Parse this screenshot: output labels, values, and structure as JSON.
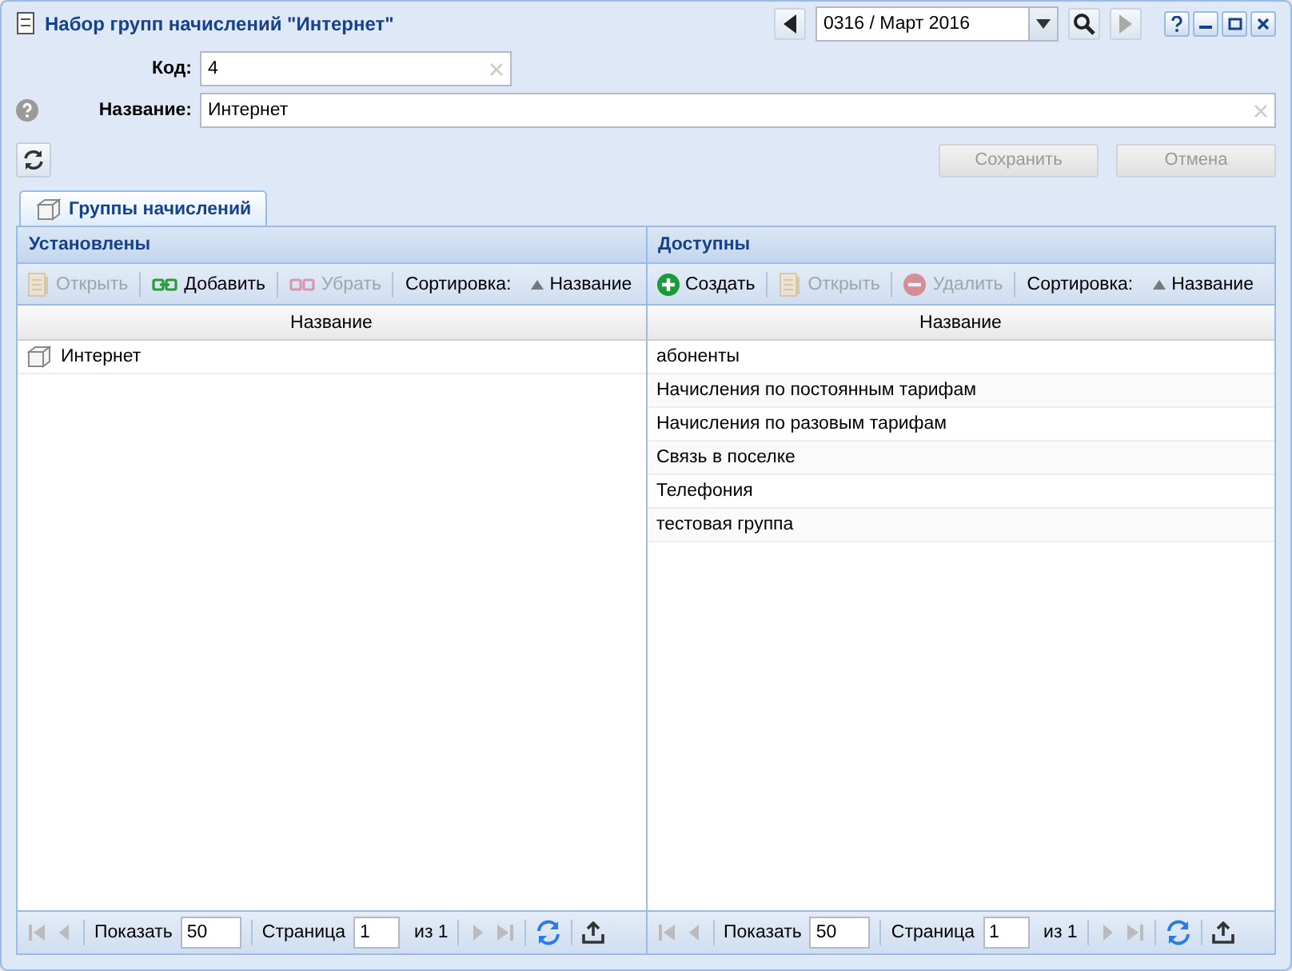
{
  "window": {
    "title": "Набор групп начислений \"Интернет\""
  },
  "period": {
    "value": "0316 / Март 2016",
    "next_disabled": true
  },
  "fields": [
    {
      "label": "Код:",
      "value": "4",
      "help": false
    },
    {
      "label": "Название:",
      "value": "Интернет",
      "help": true
    }
  ],
  "buttons": [
    {
      "label": "Сохранить",
      "disabled": true
    },
    {
      "label": "Отмена",
      "disabled": true
    }
  ],
  "tabs": [
    {
      "label": "Группы начислений",
      "selected": true
    }
  ],
  "panels": [
    {
      "title": "Установлены",
      "toolbar": [
        {
          "kind": "open",
          "label": "Открыть",
          "disabled": true
        },
        {
          "kind": "add",
          "label": "Добавить",
          "disabled": false
        },
        {
          "kind": "remove",
          "label": "Убрать",
          "disabled": true
        },
        {
          "kind": "sort",
          "label": "Сортировка:",
          "value": "Название"
        }
      ],
      "column": "Название",
      "row_icon": true,
      "rows": [
        "Интернет"
      ],
      "pager": {
        "show_label": "Показать",
        "page_size": "50",
        "page_label": "Страница",
        "page": "1",
        "of": "из 1"
      }
    },
    {
      "title": "Доступны",
      "toolbar": [
        {
          "kind": "create",
          "label": "Создать",
          "disabled": false
        },
        {
          "kind": "open",
          "label": "Открыть",
          "disabled": true
        },
        {
          "kind": "delete",
          "label": "Удалить",
          "disabled": true
        },
        {
          "kind": "sort",
          "label": "Сортировка:",
          "value": "Название"
        }
      ],
      "column": "Название",
      "row_icon": false,
      "rows": [
        "абоненты",
        "Начисления по постоянным тарифам",
        "Начисления по разовым тарифам",
        "Связь в поселке",
        "Телефония",
        "тестовая группа"
      ],
      "pager": {
        "show_label": "Показать",
        "page_size": "50",
        "page_label": "Страница",
        "page": "1",
        "of": "из 1"
      }
    }
  ]
}
